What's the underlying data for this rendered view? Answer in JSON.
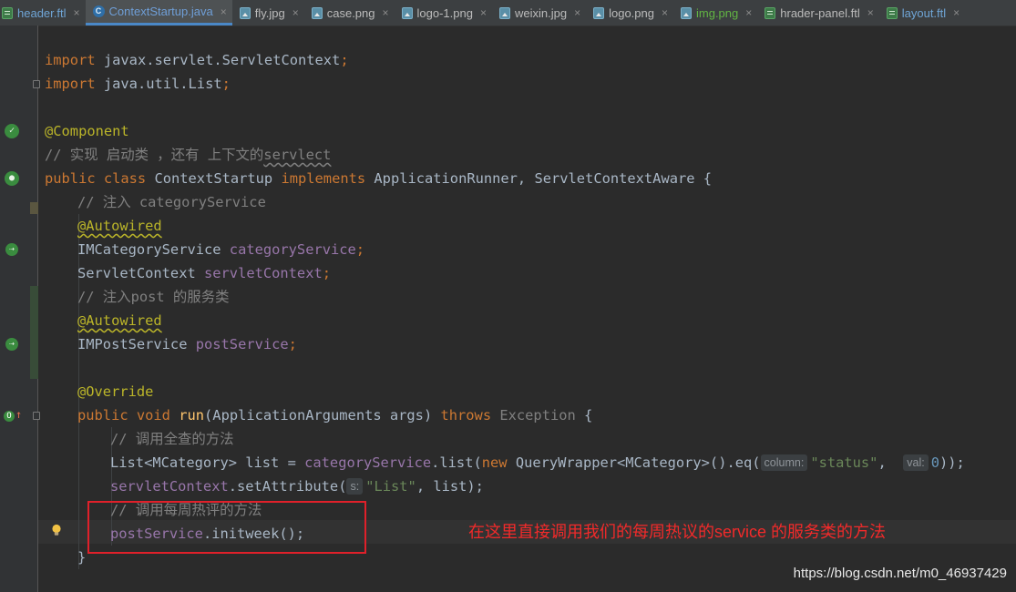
{
  "tabs": [
    {
      "label": "header.ftl",
      "icon": "ftl-file-icon",
      "active": false,
      "color": "ftlc"
    },
    {
      "label": "ContextStartup.java",
      "icon": "java-class-icon",
      "active": true,
      "color": "blue"
    },
    {
      "label": "fly.jpg",
      "icon": "image-file-icon",
      "active": false,
      "color": ""
    },
    {
      "label": "case.png",
      "icon": "image-file-icon",
      "active": false,
      "color": ""
    },
    {
      "label": "logo-1.png",
      "icon": "image-file-icon",
      "active": false,
      "color": ""
    },
    {
      "label": "weixin.jpg",
      "icon": "image-file-icon",
      "active": false,
      "color": ""
    },
    {
      "label": "logo.png",
      "icon": "image-file-icon",
      "active": false,
      "color": ""
    },
    {
      "label": "img.png",
      "icon": "image-file-icon",
      "active": false,
      "color": "imgc"
    },
    {
      "label": "hrader-panel.ftl",
      "icon": "ftl-file-icon",
      "active": false,
      "color": ""
    },
    {
      "label": "layout.ftl",
      "icon": "ftl-file-icon",
      "active": false,
      "color": "ftlc"
    }
  ],
  "tab_close_glyph": "×",
  "code": {
    "l1": {
      "a": "import",
      "b": " javax.servlet.ServletContext",
      "c": ";"
    },
    "l2": {
      "a": "import",
      "b": " java.util.List",
      "c": ";"
    },
    "l3": {
      "a": "@Component"
    },
    "l4": {
      "a": "// 实现 启动类 ，还有 上下文的",
      "b": "servlect"
    },
    "l5": {
      "a": "public class",
      "b": " ContextStartup ",
      "c": "implements",
      "d": " ApplicationRunner, ServletContextAware {"
    },
    "l6": {
      "a": "// 注入 categoryService"
    },
    "l7": {
      "a": "@Autowired"
    },
    "l8": {
      "a": "IMCategoryService ",
      "b": "categoryService",
      "c": ";"
    },
    "l9": {
      "a": "ServletContext ",
      "b": "servletContext",
      "c": ";"
    },
    "l10": {
      "a": "// 注入post 的服务类"
    },
    "l11": {
      "a": "@Autowired"
    },
    "l12": {
      "a": "IMPostService ",
      "b": "postService",
      "c": ";"
    },
    "l13": {
      "a": "@Override"
    },
    "l14": {
      "a": "public void",
      "b": "run",
      "c": "(ApplicationArguments args) ",
      "d": "throws",
      "e": " Exception",
      "f": " {"
    },
    "l15": {
      "a": "// 调用全查的方法"
    },
    "l16": {
      "a": "List<MCategory> list = ",
      "b": "categoryService",
      "c": ".list(",
      "d": "new",
      "e": " QueryWrapper<MCategory>().eq(",
      "h1": "column:",
      "f": "\"status\"",
      "g": ",  ",
      "h2": "val:",
      "i": "0",
      "j": "));"
    },
    "l17": {
      "a": "servletContext",
      "b": ".setAttribute(",
      "h": "s:",
      "c": "\"List\"",
      "d": ", list);"
    },
    "l18": {
      "a": "// 调用每周热评的方法"
    },
    "l19": {
      "a": "postService",
      "b": ".initweek();"
    },
    "l20": {
      "a": "}"
    }
  },
  "annotation_text": "在这里直接调用我们的每周热议的service 的服务类的方法",
  "watermark": "https://blog.csdn.net/m0_46937429",
  "colors": {
    "background": "#2b2b2b",
    "keyword": "#cc7832",
    "annotation": "#bbb529",
    "field": "#9876aa",
    "string": "#6a8759",
    "number": "#6897bb",
    "comment": "#808080",
    "highlight_box": "#e0202a"
  }
}
